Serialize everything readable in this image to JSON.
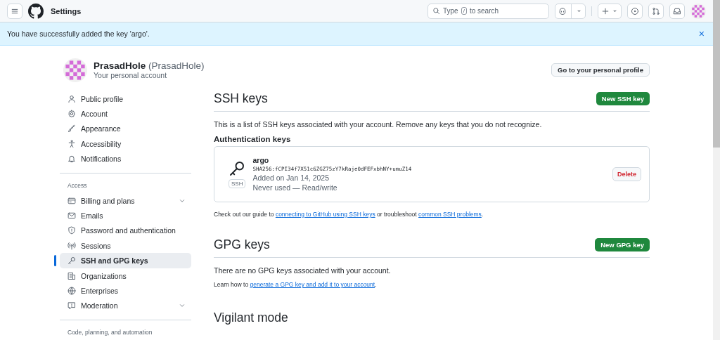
{
  "header": {
    "title": "Settings",
    "search": {
      "placeholder_before": "Type",
      "key": "/",
      "placeholder_after": "to search"
    }
  },
  "flash": {
    "message": "You have successfully added the key 'argo'.",
    "close": "×"
  },
  "profile": {
    "name": "PrasadHole",
    "login": "(PrasadHole)",
    "subtitle": "Your personal account",
    "button": "Go to your personal profile"
  },
  "sidebar": {
    "sections": [
      {
        "items": [
          {
            "label": "Public profile",
            "selected": false,
            "expandable": false
          },
          {
            "label": "Account",
            "selected": false,
            "expandable": false
          },
          {
            "label": "Appearance",
            "selected": false,
            "expandable": false
          },
          {
            "label": "Accessibility",
            "selected": false,
            "expandable": false
          },
          {
            "label": "Notifications",
            "selected": false,
            "expandable": false
          }
        ]
      },
      {
        "heading": "Access",
        "items": [
          {
            "label": "Billing and plans",
            "selected": false,
            "expandable": true
          },
          {
            "label": "Emails",
            "selected": false,
            "expandable": false
          },
          {
            "label": "Password and authentication",
            "selected": false,
            "expandable": false
          },
          {
            "label": "Sessions",
            "selected": false,
            "expandable": false
          },
          {
            "label": "SSH and GPG keys",
            "selected": true,
            "expandable": false
          },
          {
            "label": "Organizations",
            "selected": false,
            "expandable": false
          },
          {
            "label": "Enterprises",
            "selected": false,
            "expandable": false
          },
          {
            "label": "Moderation",
            "selected": false,
            "expandable": true
          }
        ]
      },
      {
        "heading": "Code, planning, and automation"
      }
    ]
  },
  "ssh": {
    "title": "SSH keys",
    "button": "New SSH key",
    "description": "This is a list of SSH keys associated with your account. Remove any keys that you do not recognize.",
    "subheading": "Authentication keys",
    "keys": [
      {
        "name": "argo",
        "badge": "SSH",
        "fingerprint": "SHA256:fCPI34f7X51c6ZGZ75zY7kRaje0dFEFxbhNY+umuZ14",
        "added": "Added on Jan 14, 2025",
        "usage": "Never used — Read/write",
        "action": "Delete"
      }
    ],
    "guide": [
      {
        "kind": "text",
        "text": "Check out our guide to "
      },
      {
        "kind": "link",
        "text": "connecting to GitHub using SSH keys"
      },
      {
        "kind": "text",
        "text": " or troubleshoot "
      },
      {
        "kind": "link",
        "text": "common SSH problems"
      },
      {
        "kind": "text",
        "text": "."
      }
    ]
  },
  "gpg": {
    "title": "GPG keys",
    "button": "New GPG key",
    "description": "There are no GPG keys associated with your account.",
    "guide": [
      {
        "kind": "text",
        "text": "Learn how to "
      },
      {
        "kind": "link",
        "text": "generate a GPG key and add it to your account"
      },
      {
        "kind": "text",
        "text": "."
      }
    ]
  },
  "vigilant": {
    "title": "Vigilant mode"
  }
}
